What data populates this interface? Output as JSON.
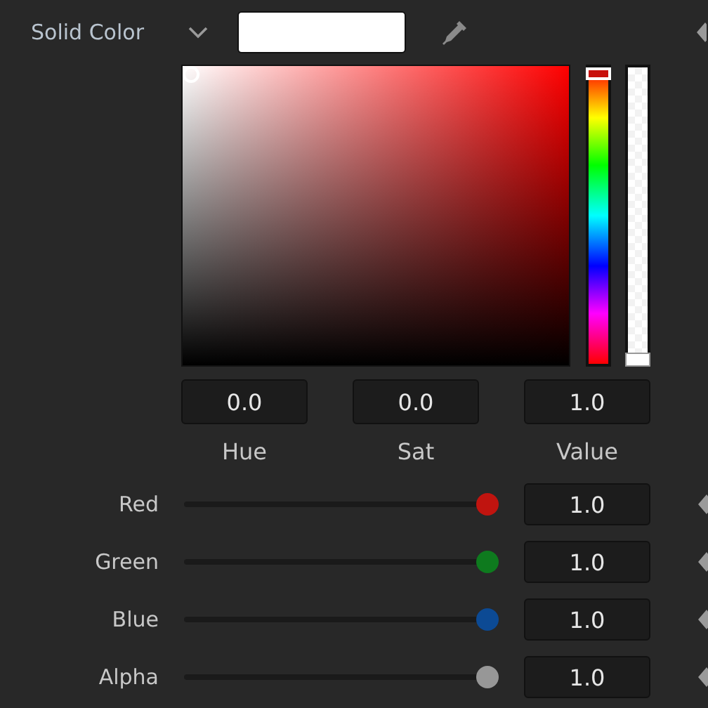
{
  "color_mode": {
    "label": "Solid Color"
  },
  "swatch": {
    "color": "#ffffff"
  },
  "hsv_fields": [
    {
      "label": "Hue",
      "value": "0.0"
    },
    {
      "label": "Sat",
      "value": "0.0"
    },
    {
      "label": "Value",
      "value": "1.0"
    }
  ],
  "sliders": [
    {
      "label": "Red",
      "level": 1,
      "value": "1.0",
      "color": "#c0140f"
    },
    {
      "label": "Green",
      "level": 1,
      "value": "1.0",
      "color": "#0e7a1e"
    },
    {
      "label": "Blue",
      "level": 1,
      "value": "1.0",
      "color": "#0c4a94"
    },
    {
      "label": "Alpha",
      "level": 1,
      "value": "1.0",
      "color": "#979797"
    }
  ]
}
